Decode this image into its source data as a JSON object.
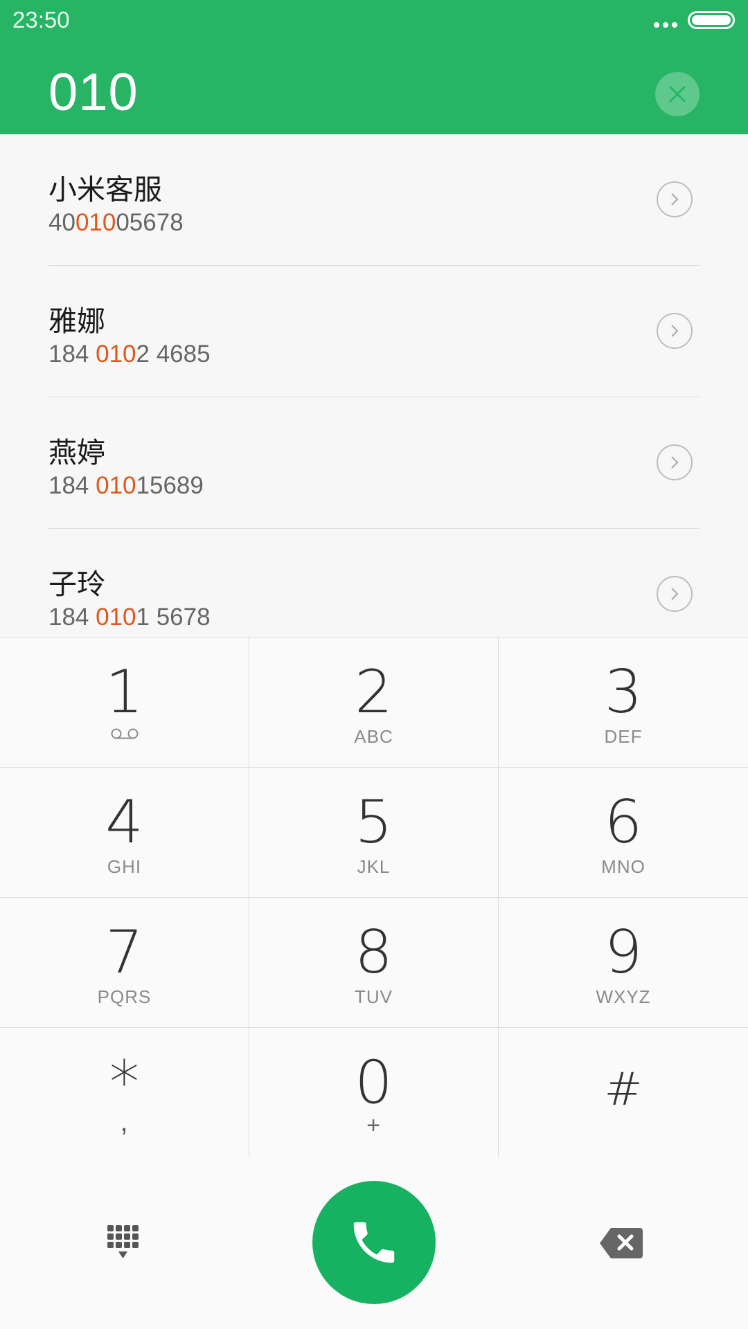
{
  "status_bar": {
    "time": "23:50",
    "more_icon": "more-dots-icon",
    "battery_icon": "battery-icon"
  },
  "header": {
    "dialed_number": "010",
    "clear_icon": "close-icon",
    "accent_color": "#27b565"
  },
  "contacts": [
    {
      "name": "小米客服",
      "number_pre": "40",
      "number_match": "010",
      "number_post": "05678"
    },
    {
      "name": "雅娜",
      "number_pre": "184 ",
      "number_match": "010",
      "number_post": "2 4685"
    },
    {
      "name": "燕婷",
      "number_pre": "184 ",
      "number_match": "010",
      "number_post": "15689"
    },
    {
      "name": "子玲",
      "number_pre": "184 ",
      "number_match": "010",
      "number_post": "1 5678"
    }
  ],
  "highlight_color": "#e0571b",
  "keypad": [
    {
      "digit": "1",
      "letters": ""
    },
    {
      "digit": "2",
      "letters": "ABC"
    },
    {
      "digit": "3",
      "letters": "DEF"
    },
    {
      "digit": "4",
      "letters": "GHI"
    },
    {
      "digit": "5",
      "letters": "JKL"
    },
    {
      "digit": "6",
      "letters": "MNO"
    },
    {
      "digit": "7",
      "letters": "PQRS"
    },
    {
      "digit": "8",
      "letters": "TUV"
    },
    {
      "digit": "9",
      "letters": "WXYZ"
    },
    {
      "digit": "*",
      "letters": ","
    },
    {
      "digit": "0",
      "letters": "+"
    },
    {
      "digit": "#",
      "letters": ""
    }
  ],
  "bottom_bar": {
    "dialpad_icon": "dialpad-icon",
    "call_icon": "phone-icon",
    "call_color": "#17b162",
    "backspace_icon": "backspace-icon"
  }
}
